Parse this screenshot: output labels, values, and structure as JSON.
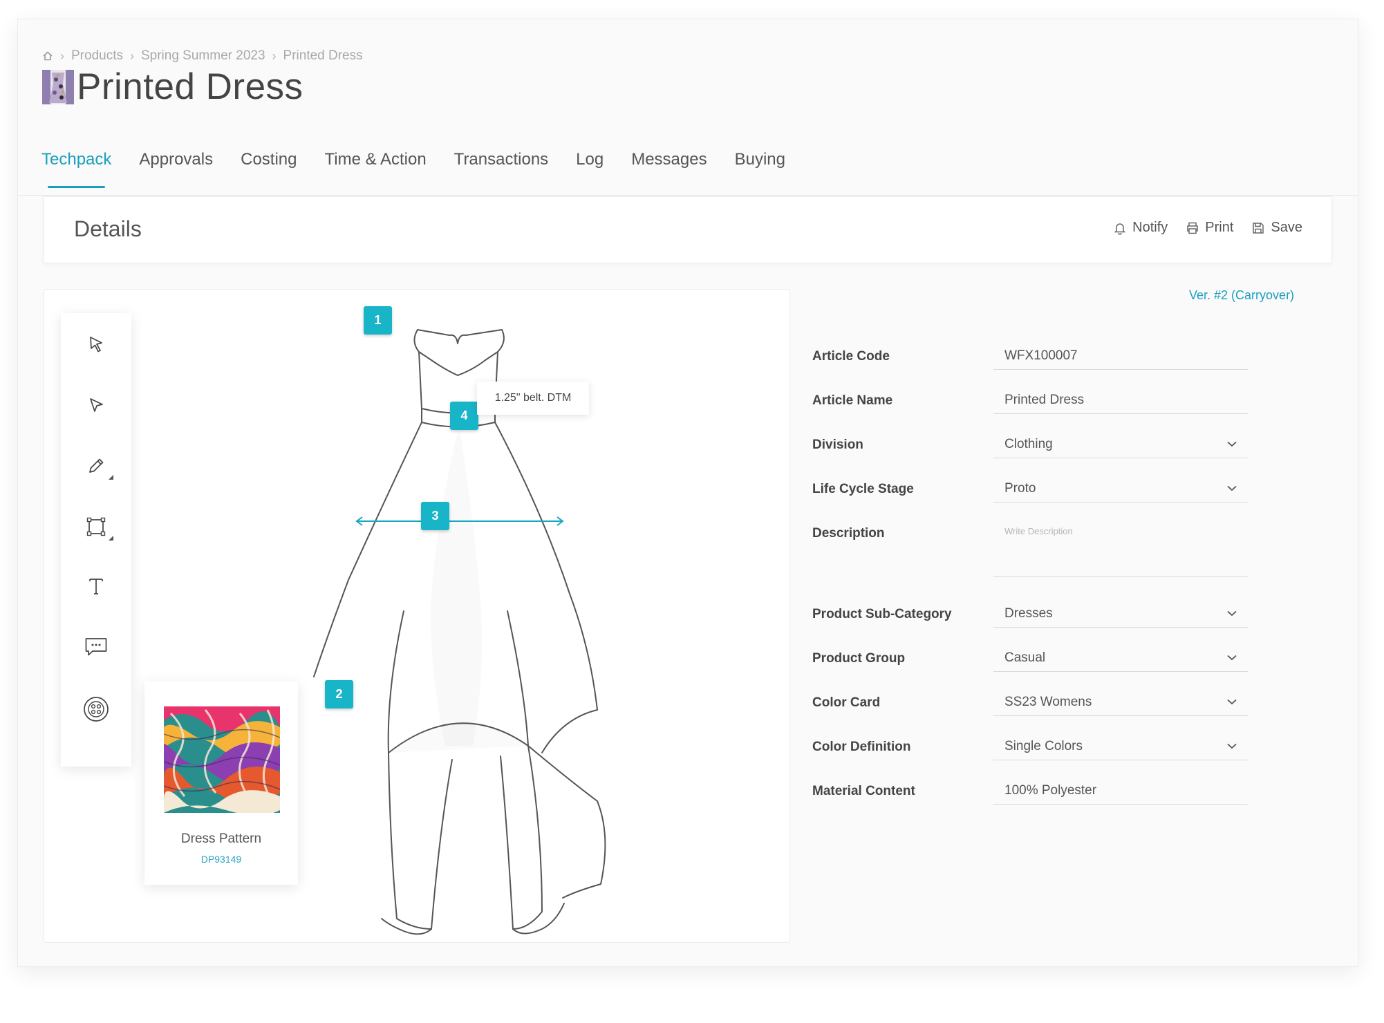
{
  "breadcrumb": {
    "home_icon": "home-icon",
    "items": [
      "Products",
      "Spring Summer 2023",
      "Printed Dress"
    ],
    "separator": "›"
  },
  "page": {
    "title": "Printed Dress"
  },
  "tabs": [
    {
      "label": "Techpack",
      "active": true
    },
    {
      "label": "Approvals",
      "active": false
    },
    {
      "label": "Costing",
      "active": false
    },
    {
      "label": "Time & Action",
      "active": false
    },
    {
      "label": "Transactions",
      "active": false
    },
    {
      "label": "Log",
      "active": false
    },
    {
      "label": "Messages",
      "active": false
    },
    {
      "label": "Buying",
      "active": false
    }
  ],
  "details": {
    "title": "Details",
    "actions": [
      {
        "label": "Notify",
        "icon": "bell-icon"
      },
      {
        "label": "Print",
        "icon": "printer-icon"
      },
      {
        "label": "Save",
        "icon": "floppy-disk-icon"
      }
    ]
  },
  "toolbar": {
    "tools": [
      "select-arrow-icon",
      "direct-select-arrow-icon",
      "pencil-icon",
      "rectangle-icon",
      "text-icon",
      "comment-icon",
      "button-icon"
    ]
  },
  "annotations": {
    "markers": [
      "1",
      "2",
      "3",
      "4"
    ],
    "callout": "1.25\" belt. DTM"
  },
  "swatch": {
    "name": "Dress Pattern",
    "code": "DP93149"
  },
  "form": {
    "version": "Ver. #2 (Carryover)",
    "article_code": {
      "label": "Article Code",
      "value": "WFX100007"
    },
    "article_name": {
      "label": "Article Name",
      "value": "Printed Dress"
    },
    "division": {
      "label": "Division",
      "value": "Clothing"
    },
    "life_cycle_stage": {
      "label": "Life Cycle Stage",
      "value": "Proto"
    },
    "description": {
      "label": "Description",
      "value": "",
      "placeholder": "Write Description"
    },
    "product_sub_category": {
      "label": "Product Sub-Category",
      "value": "Dresses"
    },
    "product_group": {
      "label": "Product Group",
      "value": "Casual"
    },
    "color_card": {
      "label": "Color Card",
      "value": "SS23 Womens"
    },
    "color_definition": {
      "label": "Color Definition",
      "value": "Single Colors"
    },
    "material_content": {
      "label": "Material Content",
      "value": "100% Polyester"
    }
  },
  "colors": {
    "accent": "#199fbd",
    "marker": "#18b4c8",
    "text": "#4a4a4a",
    "muted": "#a8a8a8"
  }
}
